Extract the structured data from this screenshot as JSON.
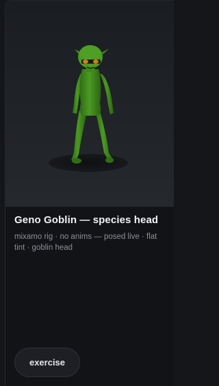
{
  "card": {
    "title": "Geno Goblin — species head",
    "description": "mixamo rig · no anims — posed live · flat tint · goblin head",
    "preview_subject": "goblin-character-model",
    "tint_color": "#3f8a1c",
    "button_label": "exercise"
  }
}
